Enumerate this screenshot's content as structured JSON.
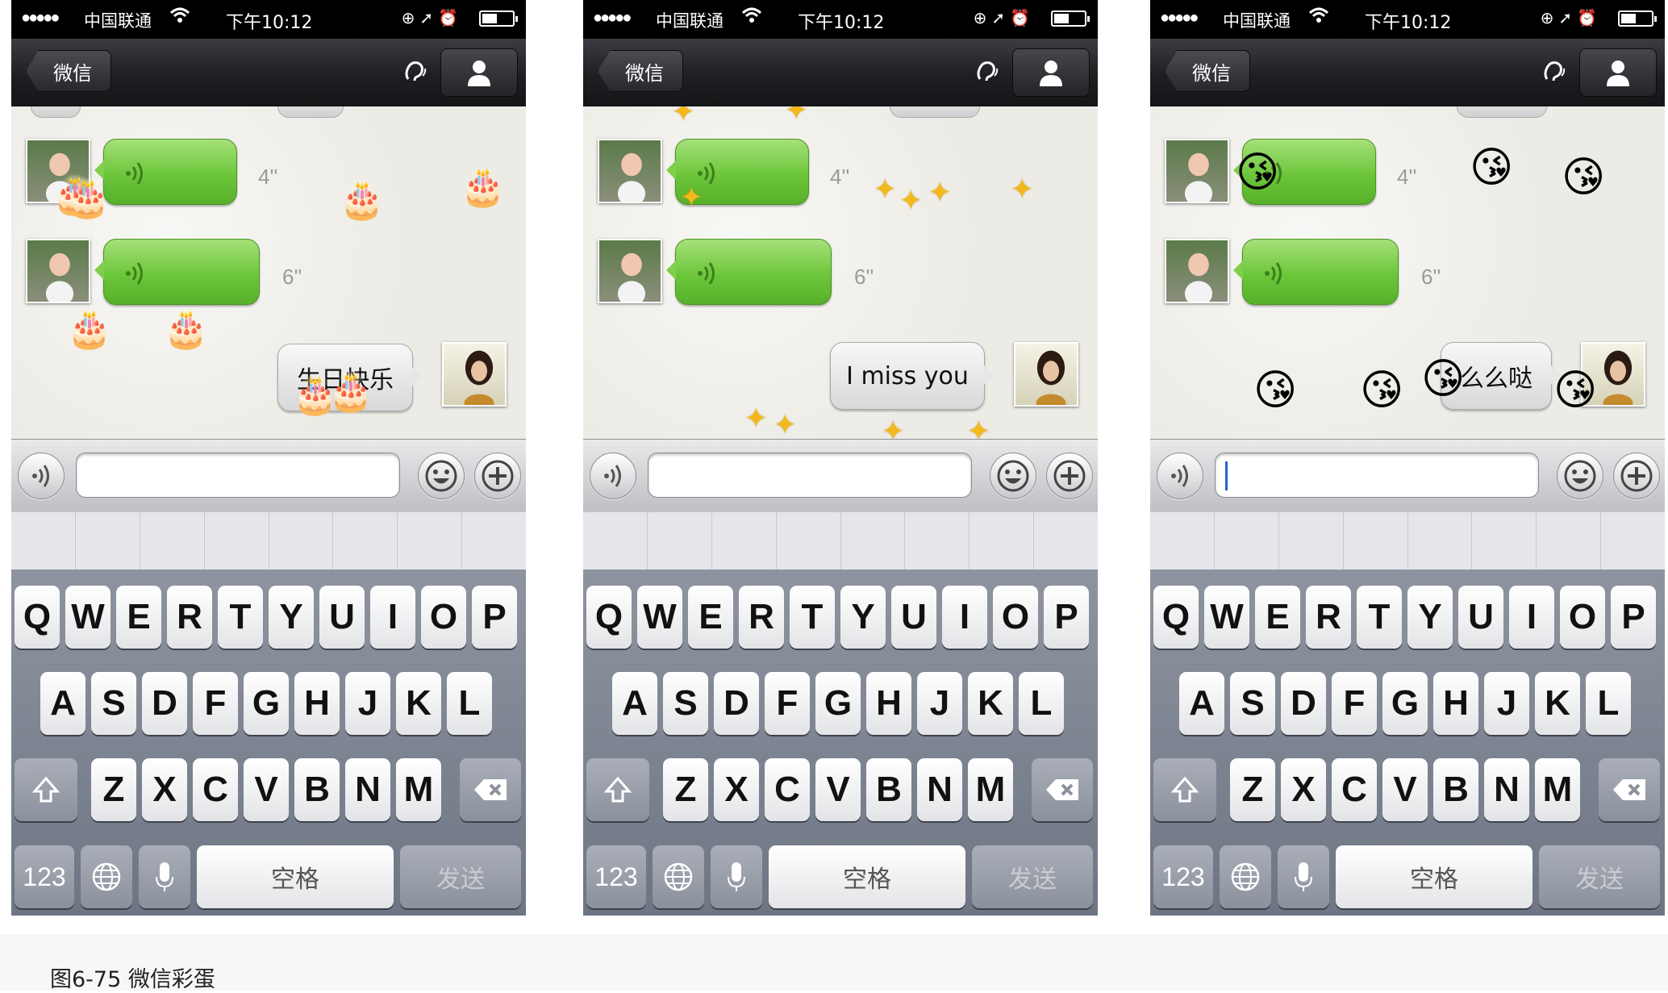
{
  "screenshots": [
    {
      "status": {
        "carrier": "中国联通",
        "time": "下午10:12"
      },
      "nav": {
        "back_label": "微信"
      },
      "messages": {
        "voice1_duration": "4''",
        "voice2_duration": "6''",
        "sent_text": "生日快乐"
      },
      "effect": {
        "name": "cake",
        "glyph": "🎂"
      }
    },
    {
      "status": {
        "carrier": "中国联通",
        "time": "下午10:12"
      },
      "nav": {
        "back_label": "微信"
      },
      "messages": {
        "voice1_duration": "4''",
        "voice2_duration": "6''",
        "sent_text": "I miss you"
      },
      "effect": {
        "name": "sparkles",
        "glyph": "✦"
      }
    },
    {
      "status": {
        "carrier": "中国联通",
        "time": "下午10:12"
      },
      "nav": {
        "back_label": "微信"
      },
      "messages": {
        "voice1_duration": "4''",
        "voice2_duration": "6''",
        "sent_text": "么么哒"
      },
      "effect": {
        "name": "kiss-face",
        "glyph": "😘"
      }
    }
  ],
  "keyboard": {
    "row1": [
      "Q",
      "W",
      "E",
      "R",
      "T",
      "Y",
      "U",
      "I",
      "O",
      "P"
    ],
    "row2": [
      "A",
      "S",
      "D",
      "F",
      "G",
      "H",
      "J",
      "K",
      "L"
    ],
    "row3": [
      "Z",
      "X",
      "C",
      "V",
      "B",
      "N",
      "M"
    ],
    "numbers_label": "123",
    "space_label": "空格",
    "send_label": "发送"
  },
  "caption": "图6-75 微信彩蛋",
  "colors": {
    "voice_bubble": "#6cc63a",
    "nav_bar": "#1d1f22",
    "keyboard": "#7a808c",
    "sparkle": "#f2b81c"
  }
}
